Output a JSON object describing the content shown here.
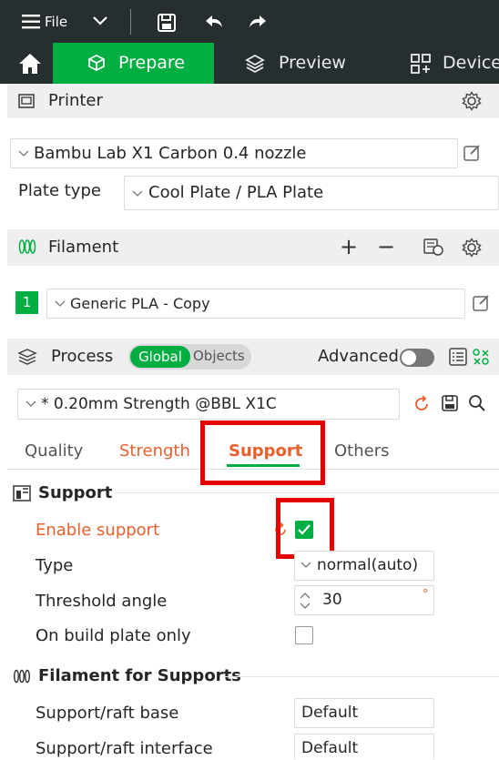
{
  "menu": {
    "file_label": "File"
  },
  "tabs": [
    {
      "label": "Prepare"
    },
    {
      "label": "Preview"
    },
    {
      "label": "Device"
    }
  ],
  "printer": {
    "title": "Printer",
    "selected": "Bambu Lab X1 Carbon 0.4 nozzle",
    "plate_type_label": "Plate type",
    "plate_type_value": "Cool Plate / PLA Plate"
  },
  "filament": {
    "title": "Filament",
    "add_label": "+",
    "remove_label": "−",
    "slot_number": "1",
    "slot_color": "#00ae42",
    "selected": "Generic PLA - Copy"
  },
  "process": {
    "title": "Process",
    "global_label": "Global",
    "objects_label": "Objects",
    "advanced_label": "Advanced",
    "advanced_on": false,
    "preset": "* 0.20mm Strength @BBL X1C"
  },
  "process_tabs": [
    {
      "label": "Quality"
    },
    {
      "label": "Strength"
    },
    {
      "label": "Support"
    },
    {
      "label": "Others"
    }
  ],
  "support": {
    "group_title": "Support",
    "enable_label": "Enable support",
    "enable_checked": true,
    "type_label": "Type",
    "type_value": "normal(auto)",
    "threshold_label": "Threshold angle",
    "threshold_value": "30",
    "threshold_unit": "°",
    "build_plate_label": "On build plate only",
    "build_plate_checked": false
  },
  "filament_support": {
    "group_title": "Filament for Supports",
    "base_label": "Support/raft base",
    "base_value": "Default",
    "interface_label": "Support/raft interface",
    "interface_value": "Default"
  },
  "colors": {
    "accent": "#00ae42",
    "topbar": "#262e30",
    "modified_label": "#e8602c",
    "highlight_box": "#e60000"
  }
}
